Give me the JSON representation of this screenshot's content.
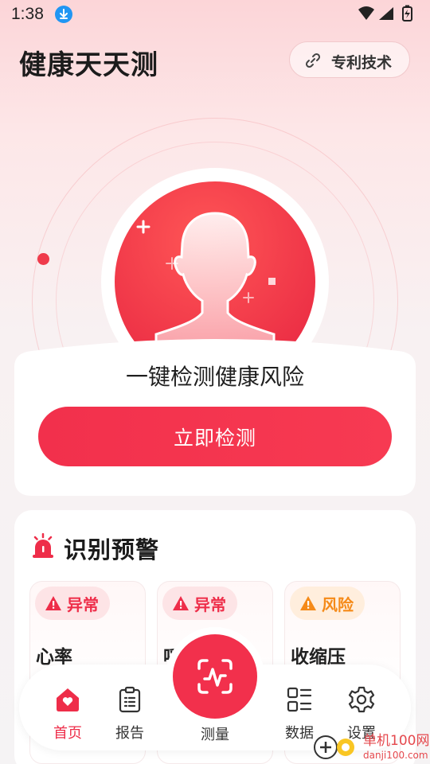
{
  "status_bar": {
    "time": "1:38"
  },
  "header": {
    "app_title": "健康天天测",
    "patent_label": "专利技术"
  },
  "hero": {
    "detect_title": "一键检测健康风险",
    "detect_button": "立即检测"
  },
  "warnings": {
    "title": "识别预警",
    "cards": [
      {
        "tag": "异常",
        "tag_level": "abnormal",
        "metric": "心率"
      },
      {
        "tag": "异常",
        "tag_level": "abnormal",
        "metric": "呼"
      },
      {
        "tag": "风险",
        "tag_level": "risk",
        "metric": "收缩压"
      }
    ]
  },
  "nav": {
    "items": [
      {
        "label": "首页",
        "icon": "home-heart-icon",
        "active": true
      },
      {
        "label": "报告",
        "icon": "clipboard-icon",
        "active": false
      },
      {
        "label": "测量",
        "icon": "scan-pulse-icon",
        "active": false
      },
      {
        "label": "数据",
        "icon": "data-list-icon",
        "active": false
      },
      {
        "label": "设置",
        "icon": "gear-icon",
        "active": false
      }
    ]
  },
  "watermark": {
    "text": "单机100网",
    "sub": "danji100.com"
  },
  "colors": {
    "accent": "#f2304c",
    "warning_orange": "#f58a18",
    "download_blue": "#2196f3"
  }
}
